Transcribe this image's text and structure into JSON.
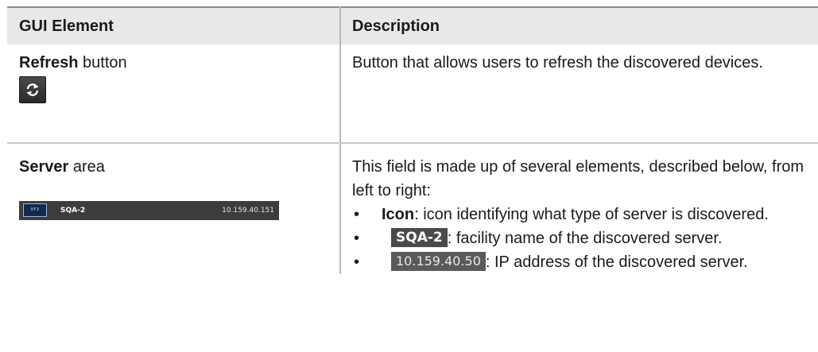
{
  "table": {
    "headers": {
      "col1": "GUI Element",
      "col2": "Description"
    },
    "row1": {
      "element_bold": "Refresh",
      "element_rest": " button",
      "icon": "refresh-icon",
      "description": "Button that allows users to refresh the discovered devices."
    },
    "row2": {
      "element_bold": "Server",
      "element_rest": " area",
      "server_bar": {
        "icon_text": "XF3",
        "name": "SQA-2",
        "ip": "10.159.40.151"
      },
      "description": "This field is made up of several elements, described below, from left to right:",
      "bullets": [
        {
          "bullet": "•",
          "bold": "Icon",
          "text": ": icon identifying what type of server is discovered."
        },
        {
          "bullet": "•",
          "chip": "SQA-2",
          "text": ": facility name of the discovered server."
        },
        {
          "bullet": "•",
          "chip": "10.159.40.50",
          "text": ": IP address of the discovered server."
        }
      ]
    }
  }
}
